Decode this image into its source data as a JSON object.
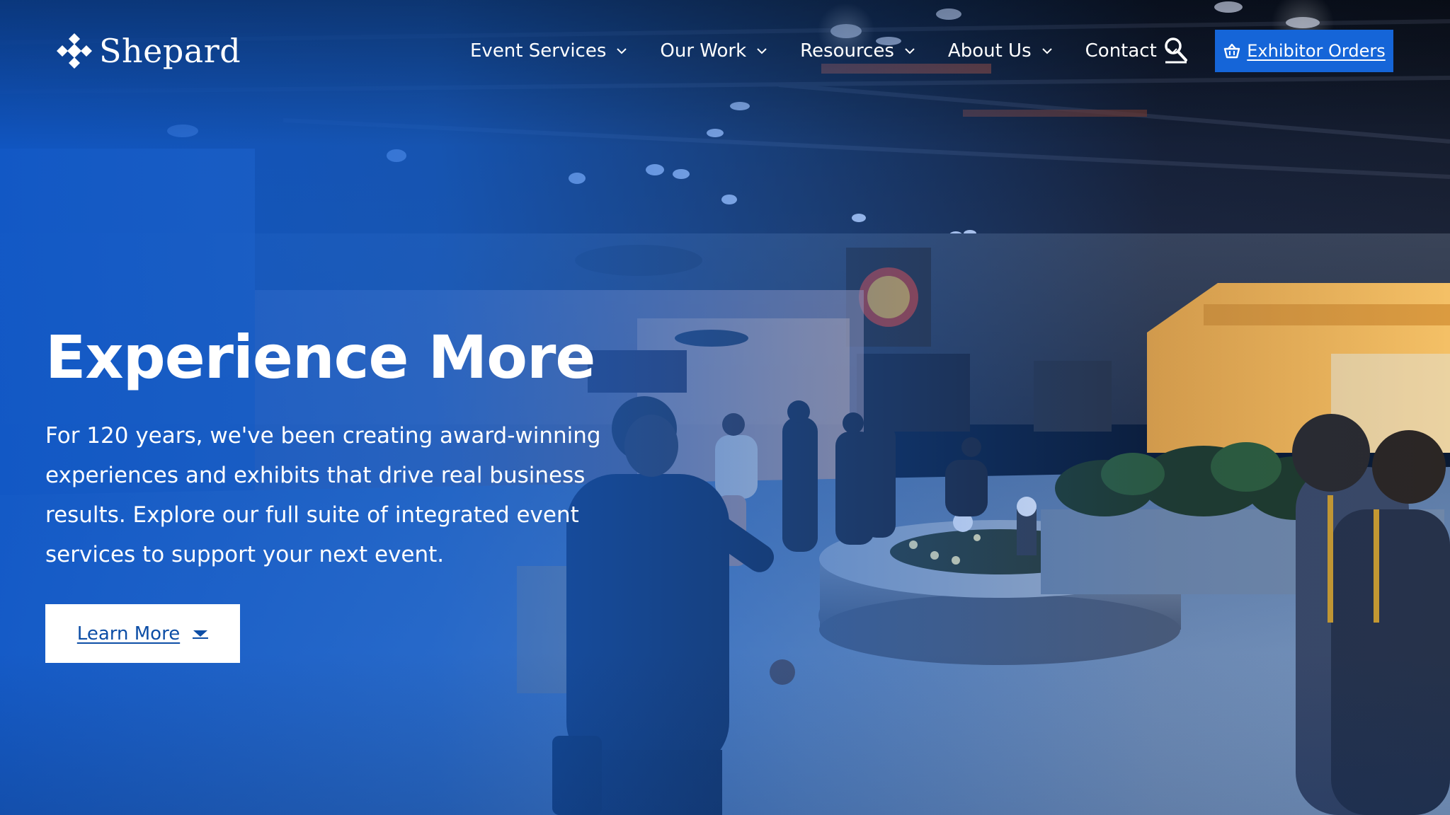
{
  "brand": {
    "name": "Shepard"
  },
  "nav": {
    "items": [
      {
        "label": "Event Services"
      },
      {
        "label": "Our Work"
      },
      {
        "label": "Resources"
      },
      {
        "label": "About Us"
      },
      {
        "label": "Contact"
      }
    ],
    "search_icon": "search-icon",
    "exhibitor_orders_label": "Exhibitor Orders",
    "exhibitor_icon": "shopping-basket-icon"
  },
  "hero": {
    "headline": "Experience More",
    "body": "For 120 years, we've been creating award-winning experiences and exhibits that drive real business results. Explore our full suite of integrated event services to support your next event.",
    "cta_label": "Learn More",
    "cta_icon": "caret-down-icon"
  },
  "colors": {
    "accent": "#1565d8",
    "overlay_blue": "#1058c8",
    "cta_text": "#0d4ea6",
    "white": "#ffffff"
  }
}
